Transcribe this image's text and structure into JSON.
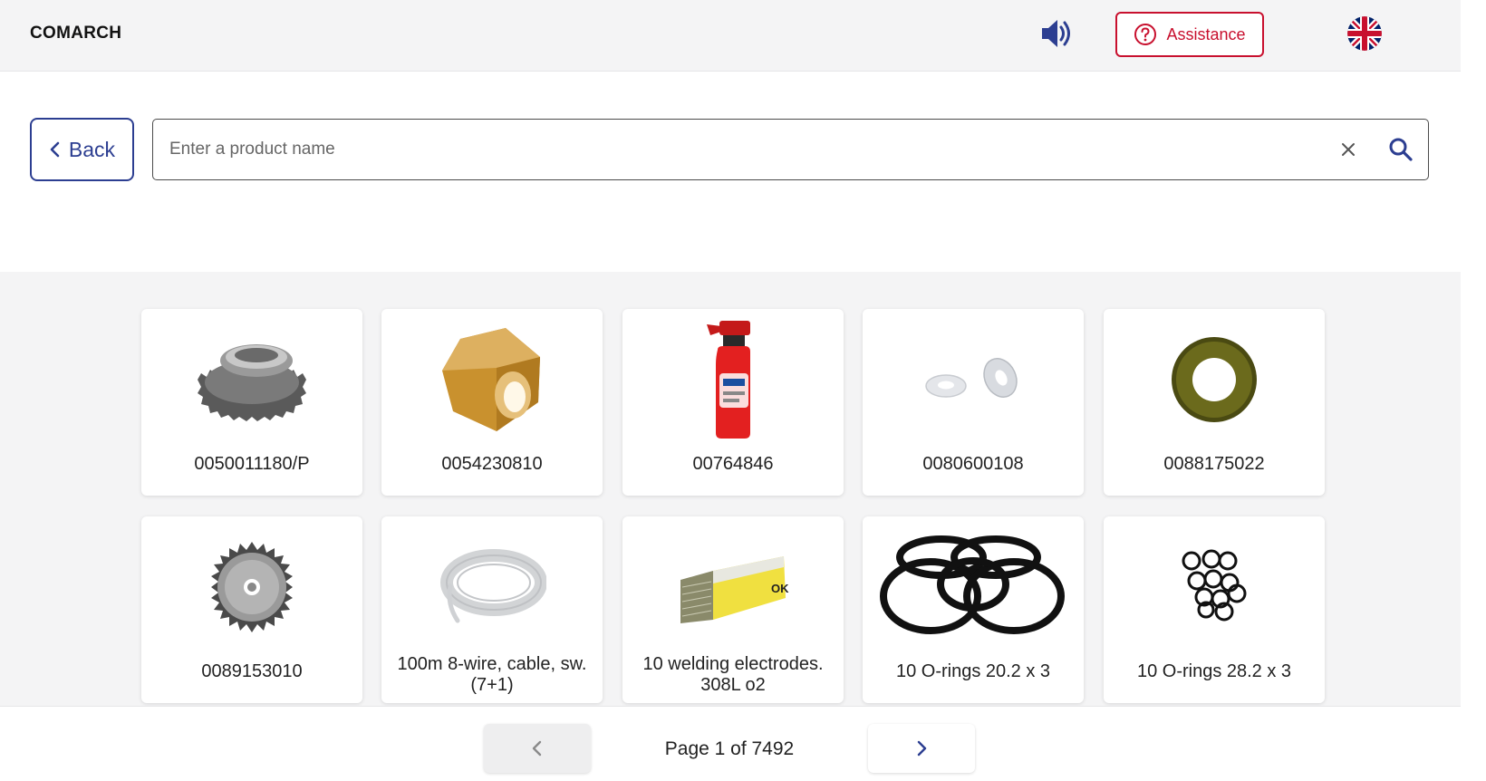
{
  "header": {
    "logo": "COMARCH",
    "assistance_label": "Assistance"
  },
  "toolbar": {
    "back_label": "Back"
  },
  "search": {
    "placeholder": "Enter a product name",
    "value": ""
  },
  "products": [
    {
      "label": "0050011180/P",
      "icon": "gear-icon"
    },
    {
      "label": "0054230810",
      "icon": "brass-nut-icon"
    },
    {
      "label": "00764846",
      "icon": "spray-bottle-icon"
    },
    {
      "label": "0080600108",
      "icon": "washers-icon"
    },
    {
      "label": "0088175022",
      "icon": "ring-washer-icon"
    },
    {
      "label": "0089153010",
      "icon": "saw-blade-icon"
    },
    {
      "label": "100m 8-wire, cable, sw. (7+1)",
      "icon": "cable-coil-icon"
    },
    {
      "label": "10 welding electrodes. 308L o2",
      "icon": "electrodes-icon"
    },
    {
      "label": "10 O-rings 20.2 x 3",
      "icon": "o-rings-large-icon"
    },
    {
      "label": "10 O-rings 28.2 x 3",
      "icon": "o-rings-small-icon"
    }
  ],
  "pagination": {
    "text": "Page 1 of 7492",
    "current": 1,
    "total": 7492
  },
  "colors": {
    "accent": "#2c3e91",
    "assistance": "#c8102e",
    "background": "#f4f4f5"
  }
}
